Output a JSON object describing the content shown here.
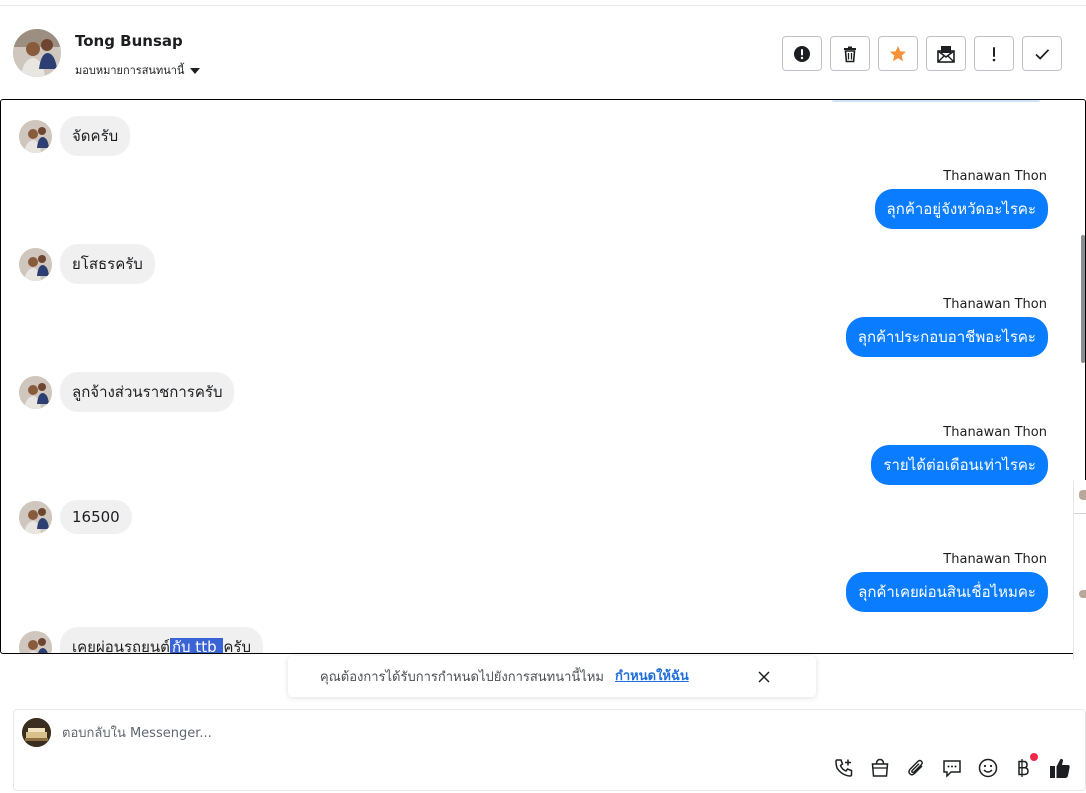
{
  "header": {
    "contact_name": "Tong Bunsap",
    "assign_label": "มอบหมายการสนทนานี้",
    "actions": [
      {
        "icon": "alert-circle-icon",
        "name": "mark-spam-button"
      },
      {
        "icon": "trash-icon",
        "name": "delete-button"
      },
      {
        "icon": "star-icon",
        "name": "star-button"
      },
      {
        "icon": "mark-unread-icon",
        "name": "mark-unread-button"
      },
      {
        "icon": "exclamation-icon",
        "name": "follow-up-button"
      },
      {
        "icon": "checkmark-icon",
        "name": "done-button"
      }
    ],
    "star_color": "#f7923b"
  },
  "messages": [
    {
      "direction": "in",
      "text": "จัดครับ"
    },
    {
      "direction": "out",
      "sender": "Thanawan Thon",
      "text": "ลุกค้าอยู่จังหวัดอะไรคะ"
    },
    {
      "direction": "in",
      "text": "ยโสธรครับ"
    },
    {
      "direction": "out",
      "sender": "Thanawan Thon",
      "text": "ลุกค้าประกอบอาชีพอะไรคะ"
    },
    {
      "direction": "in",
      "text": "ลูกจ้างส่วนราชการครับ"
    },
    {
      "direction": "out",
      "sender": "Thanawan Thon",
      "text": "รายได้ต่อเดือนเท่าไรคะ"
    },
    {
      "direction": "in",
      "text": "16500"
    },
    {
      "direction": "out",
      "sender": "Thanawan Thon",
      "text": "ลุกค้าเคยผ่อนสินเชื่อไหมคะ"
    },
    {
      "direction": "in",
      "text_before": "เคยผ่อนรถยนต์",
      "text_highlight": "กับ ttb ",
      "text_after": "ครับ"
    }
  ],
  "toast": {
    "text": "คุณต้องการได้รับการกำหนดไปยังการสนทนานี้ไหม",
    "link": "กำหนดให้ฉัน"
  },
  "composer": {
    "placeholder": "ตอบกลับใน Messenger...",
    "tools": [
      "phone-plus-icon",
      "shopping-bag-icon",
      "paperclip-icon",
      "saved-reply-icon",
      "emoji-icon",
      "baht-icon",
      "thumbs-up-icon"
    ]
  },
  "colors": {
    "outgoing_bubble": "#0a7cff",
    "incoming_bubble": "#f0f0f0",
    "link": "#216fdb",
    "notification_dot": "#f0284a"
  }
}
